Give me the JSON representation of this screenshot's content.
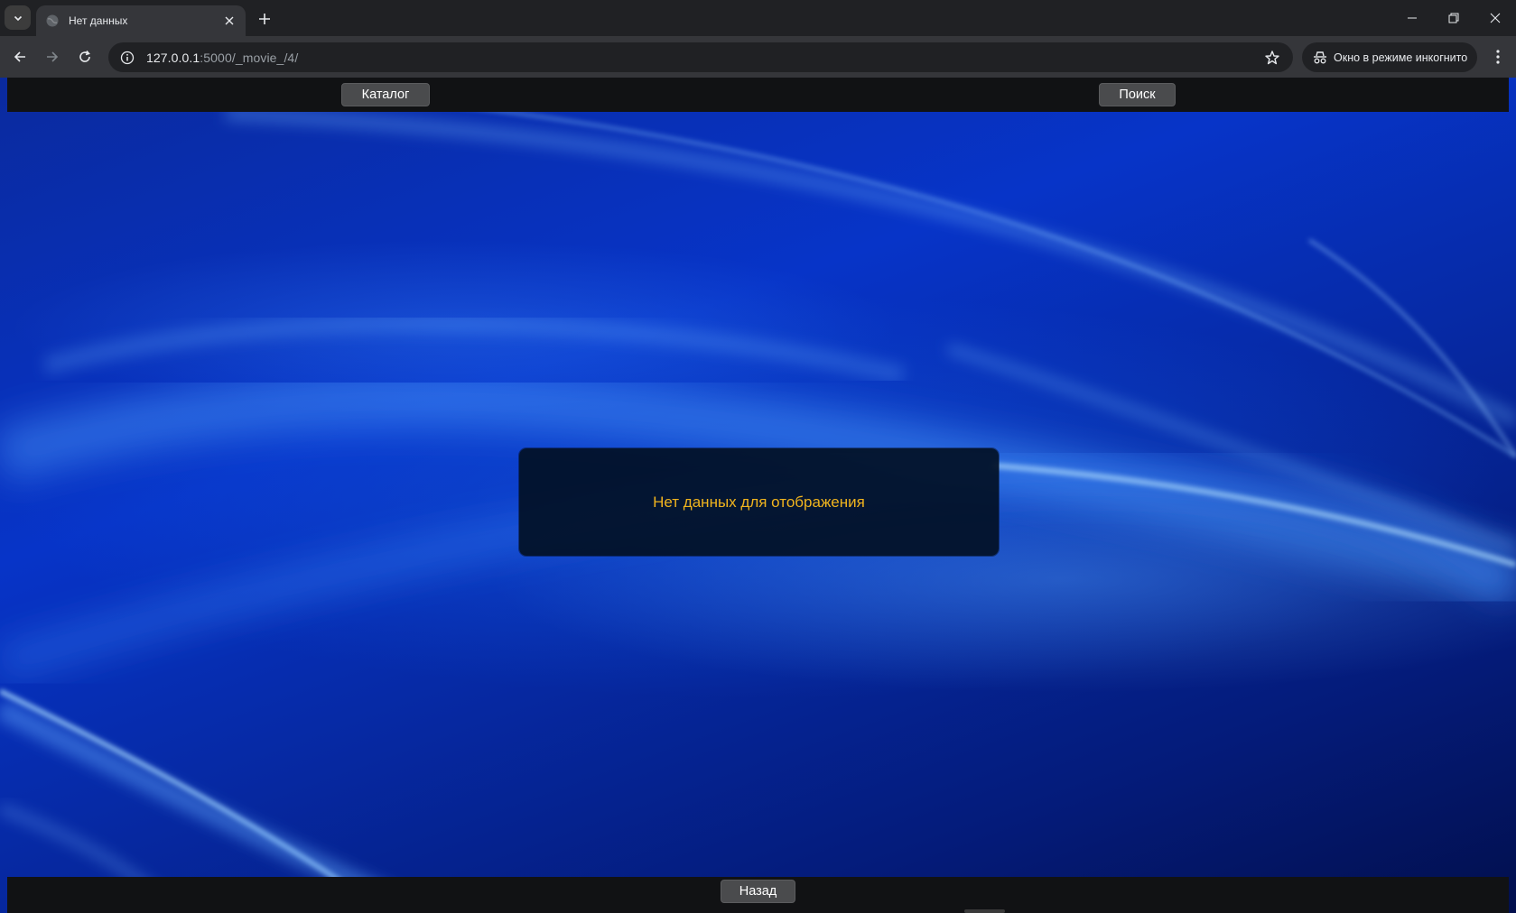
{
  "browser": {
    "tab_title": "Нет данных",
    "url_host": "127.0.0.1",
    "url_rest": ":5000/_movie_/4/",
    "incognito_label": "Окно в режиме инкогнито"
  },
  "page": {
    "nav": {
      "catalog_label": "Каталог",
      "search_label": "Поиск"
    },
    "message": "Нет данных для отображения",
    "footer": {
      "back_label": "Назад"
    },
    "colors": {
      "message_text": "#f0b41e",
      "nav_bar": "#111214",
      "button_bg": "#4a4b4d"
    }
  }
}
